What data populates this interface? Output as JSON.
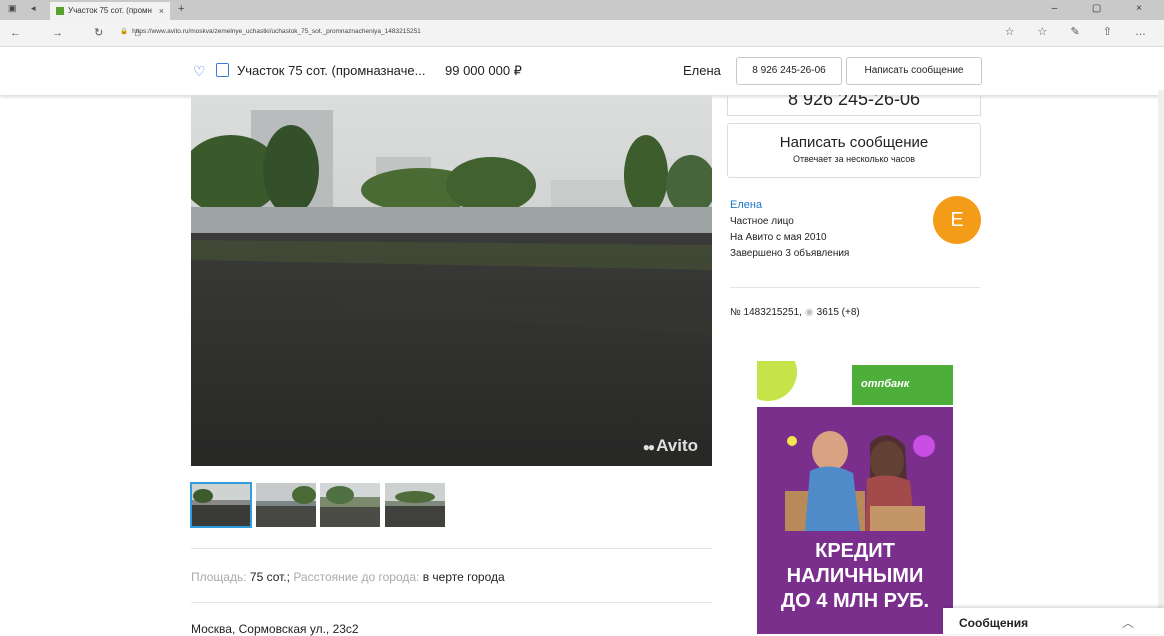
{
  "browser": {
    "tab_title": "Участок 75 сот. (промн",
    "tab_close": "×",
    "new_tab": "+",
    "url": "https://www.avito.ru/moskva/zemelnye_uchastki/uchastok_75_sot._promnaznacheniya_1483215251",
    "tab_icons": "▣ ◂",
    "nav_icons": "← → ↻ ⌂",
    "window_controls": "– ▢ ×",
    "right_icons": "☆ ☆ ✎ ⇧ …"
  },
  "sticky": {
    "title": "Участок 75 сот. (промназначе...",
    "price": "99 000 000 ₽",
    "seller": "Елена",
    "phone_button": "8 926 245-26-06",
    "message_button": "Написать сообщение"
  },
  "photo": {
    "watermark": "Avito",
    "thumbnails": 4
  },
  "params": {
    "area_label": "Площадь:",
    "area_value": "75 сот.;",
    "distance_label": "Расстояние до города:",
    "distance_value": "в черте города"
  },
  "address": "Москва, Сормовская ул., 23с2",
  "sidebar": {
    "phone": "8 926 245-26-06",
    "message_title": "Написать сообщение",
    "message_subtitle": "Отвечает за несколько часов",
    "seller_name": "Елена",
    "seller_type": "Частное лицо",
    "seller_since": "На Авито с мая 2010",
    "seller_completed": "Завершено 3 объявления",
    "avatar_letter": "E",
    "ad_number": "№ 1483215251,",
    "views": "3615 (+8)"
  },
  "banner": {
    "brand": "отпбанк",
    "line1": "КРЕДИТ",
    "line2": "НАЛИЧНЫМИ",
    "line3": "ДО 4 МЛН РУБ."
  },
  "messages": {
    "label": "Сообщения",
    "chevron": "︿"
  }
}
